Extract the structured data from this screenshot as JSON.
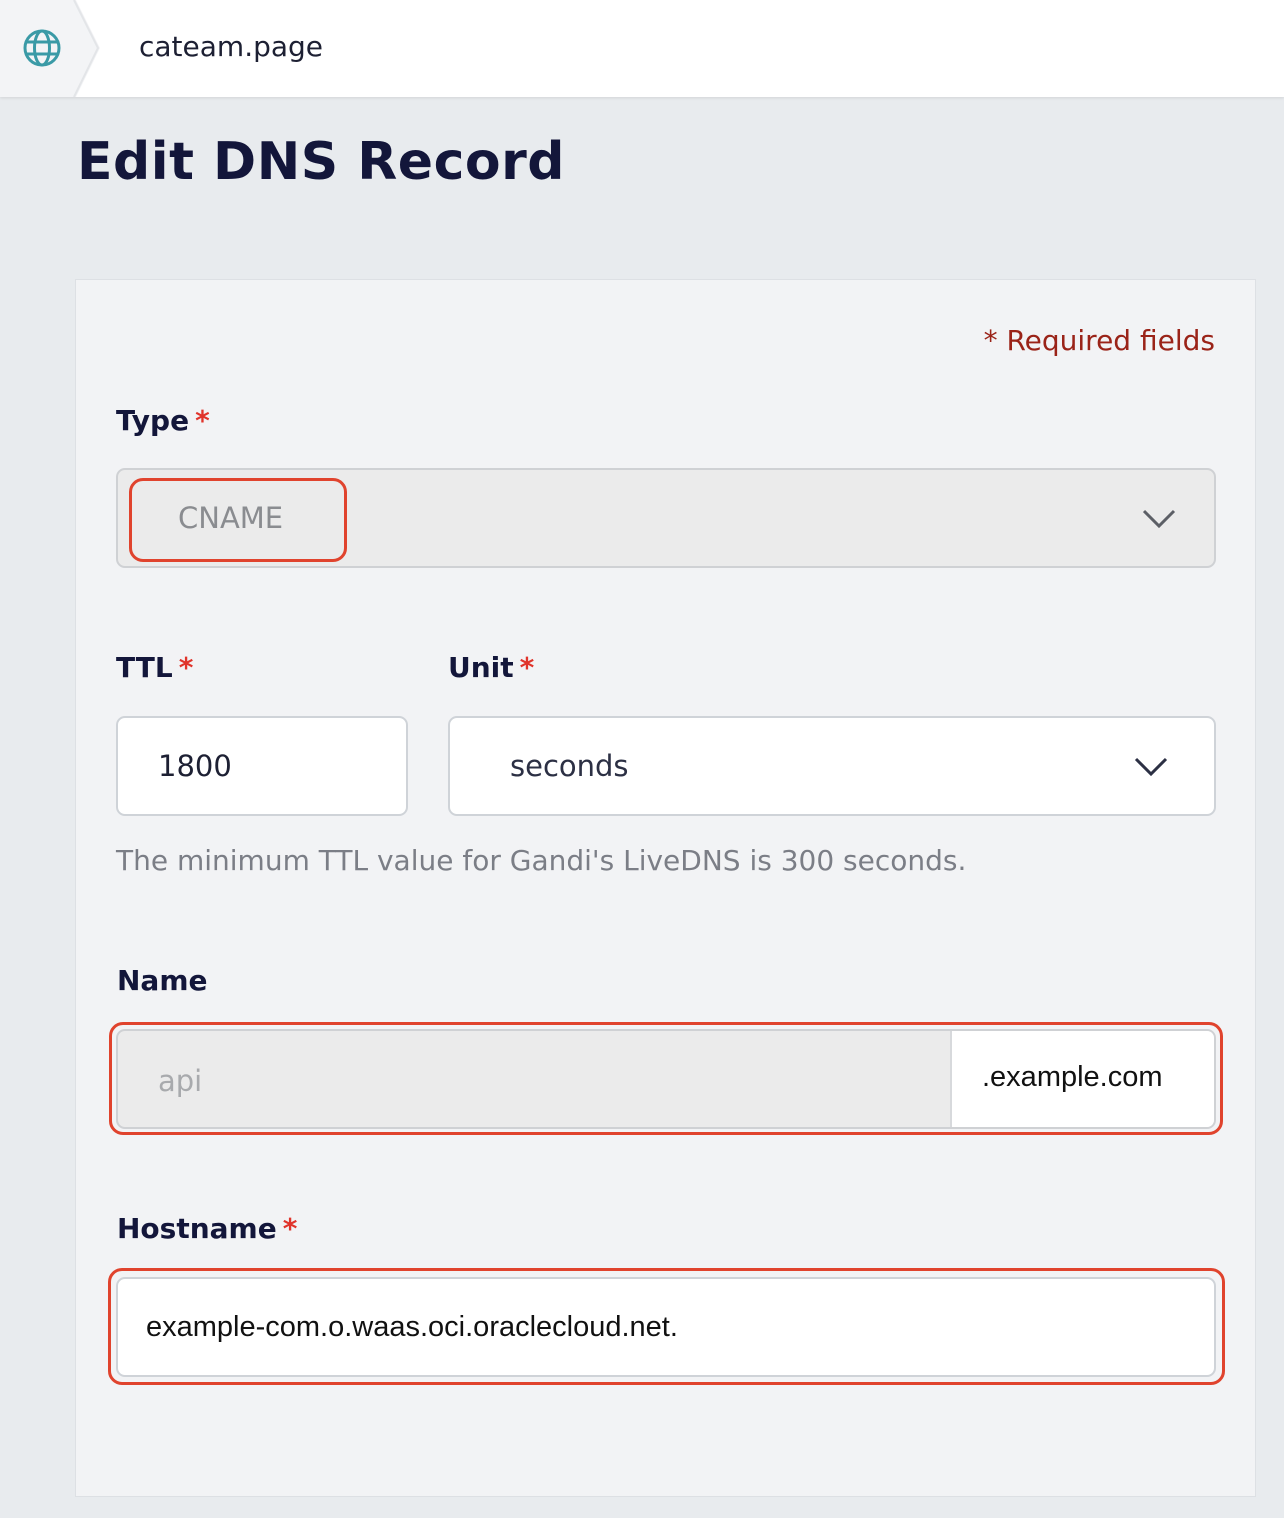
{
  "breadcrumb": {
    "home_icon": "globe-icon",
    "domain": "cateam.page"
  },
  "page": {
    "title": "Edit DNS Record"
  },
  "form": {
    "required_note": "* Required fields",
    "type": {
      "label": "Type",
      "required_mark": "*",
      "value": "CNAME",
      "icon": "chevron-down-icon"
    },
    "ttl": {
      "label": "TTL",
      "required_mark": "*",
      "value": "1800"
    },
    "unit": {
      "label": "Unit",
      "required_mark": "*",
      "value": "seconds",
      "icon": "chevron-down-icon"
    },
    "ttl_hint": "The minimum TTL value for Gandi's LiveDNS is 300 seconds.",
    "name": {
      "label": "Name",
      "value": "api",
      "suffix": ".example.com"
    },
    "hostname": {
      "label": "Hostname",
      "required_mark": "*",
      "value": "example-com.o.waas.oci.oraclecloud.net."
    }
  },
  "colors": {
    "highlight": "#e0432d",
    "required": "#e0342b",
    "required_note": "#9a2318",
    "title": "#13163a",
    "accent_icon": "#3a9aa6"
  }
}
